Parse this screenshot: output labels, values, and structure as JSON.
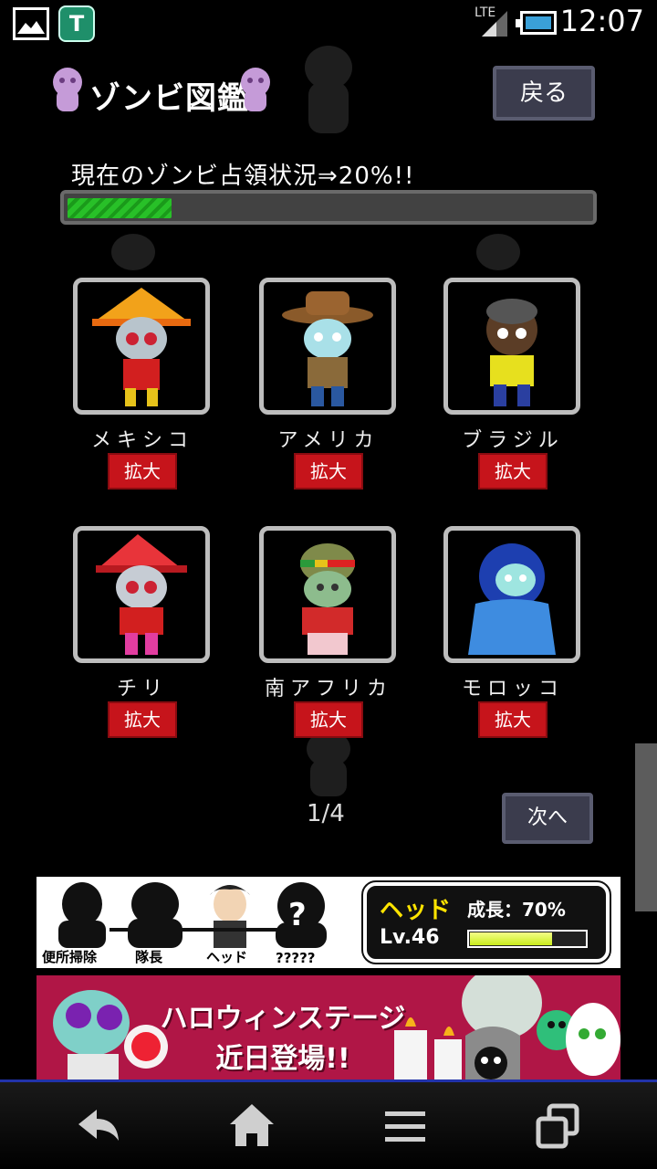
{
  "status_bar": {
    "time": "12:07",
    "network": "LTE",
    "icons": [
      "image-icon",
      "app-t-icon",
      "signal-icon",
      "battery-icon"
    ],
    "app_letter": "T"
  },
  "header": {
    "title": "ゾンビ図鑑",
    "back_label": "戻る"
  },
  "occupation": {
    "text": "現在のゾンビ占領状況⇒20%!!",
    "progress": 0.2
  },
  "zombies": [
    {
      "name": "メキシコ",
      "zoom_label": "拡大"
    },
    {
      "name": "アメリカ",
      "zoom_label": "拡大"
    },
    {
      "name": "ブラジル",
      "zoom_label": "拡大"
    },
    {
      "name": "チリ",
      "zoom_label": "拡大"
    },
    {
      "name": "南アフリカ",
      "zoom_label": "拡大"
    },
    {
      "name": "モロッコ",
      "zoom_label": "拡大"
    }
  ],
  "pagination": {
    "page": "1/4",
    "next_label": "次へ"
  },
  "ad_ranking": {
    "labels": [
      "便所掃除",
      "隊長",
      "ヘッド",
      "?????"
    ],
    "unknown_mark": "?",
    "rank": "ヘッド",
    "growth": "成長：70%",
    "growth_value": 0.7,
    "level": "Lv.46"
  },
  "ad_halloween": {
    "line1": "ハロウィンステージ",
    "line2": "近日登場!!"
  },
  "nav": [
    "back-icon",
    "home-icon",
    "menu-icon",
    "recent-apps-icon"
  ],
  "colors": {
    "progress": "#28c028",
    "zoom_button": "#c6141b",
    "nav_button": "#3b3c4d",
    "ad_banner": "#b01646"
  }
}
